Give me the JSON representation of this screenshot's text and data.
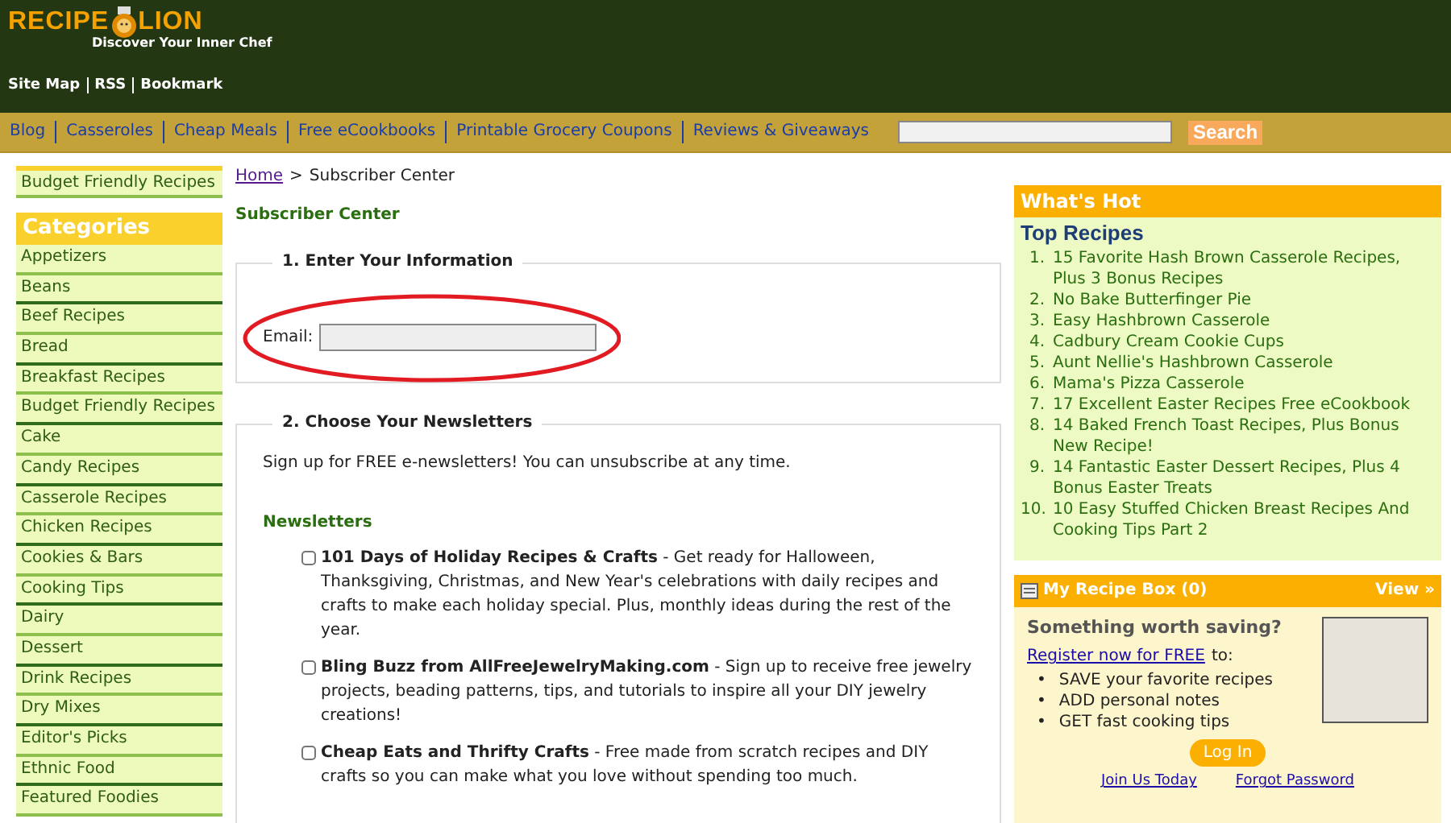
{
  "header": {
    "logo_left": "RECIPE",
    "logo_right": "LION",
    "tagline": "Discover Your Inner Chef",
    "top_links": [
      "Site Map",
      "RSS",
      "Bookmark"
    ]
  },
  "nav": {
    "items": [
      "Blog",
      "Casseroles",
      "Cheap Meals",
      "Free eCookbooks",
      "Printable Grocery Coupons",
      "Reviews & Giveaways"
    ],
    "search_button": "Search"
  },
  "sidebar": {
    "promo": "Budget Friendly Recipes",
    "categories_title": "Categories",
    "categories": [
      "Appetizers",
      "Beans",
      "Beef Recipes",
      "Bread",
      "Breakfast Recipes",
      "Budget Friendly Recipes",
      "Cake",
      "Candy Recipes",
      "Casserole Recipes",
      "Chicken Recipes",
      "Cookies & Bars",
      "Cooking Tips",
      "Dairy",
      "Dessert",
      "Drink Recipes",
      "Dry Mixes",
      "Editor's Picks",
      "Ethnic Food",
      "Featured Foodies"
    ]
  },
  "breadcrumb": {
    "home": "Home",
    "separator": ">",
    "current": "Subscriber Center"
  },
  "page_title": "Subscriber Center",
  "section_1": {
    "legend": "1. Enter Your Information",
    "email_label": "Email:"
  },
  "section_2": {
    "legend": "2. Choose Your Newsletters",
    "intro": "Sign up for FREE e-newsletters! You can unsubscribe at any time.",
    "heading": "Newsletters",
    "newsletters": [
      {
        "checked": false,
        "text": "**101 Days of Holiday Recipes & Crafts** - Get ready for Halloween, Thanksgiving, Christmas, and New Year's celebrations with daily recipes and crafts to make each holiday special. Plus, monthly ideas during the rest of the year."
      },
      {
        "checked": false,
        "text": "**Bling Buzz from AllFreeJewelryMaking.com** - Sign up to receive free jewelry projects, beading patterns, tips, and tutorials to inspire all your DIY jewelry creations!"
      },
      {
        "checked": false,
        "text": "**Cheap Eats and Thrifty Crafts** - Free made from scratch recipes and DIY crafts so you can make what you love without spending too much."
      }
    ]
  },
  "whats_hot": {
    "title": "What's Hot",
    "subtitle": "Top Recipes",
    "recipes": [
      {
        "number": "1.",
        "title": "15 Favorite Hash Brown Casserole Recipes, Plus 3 Bonus Recipes"
      },
      {
        "number": "2.",
        "title": "No Bake Butterfinger Pie"
      },
      {
        "number": "3.",
        "title": "Easy Hashbrown Casserole"
      },
      {
        "number": "4.",
        "title": "Cadbury Cream Cookie Cups"
      },
      {
        "number": "5.",
        "title": "Aunt Nellie's Hashbrown Casserole"
      },
      {
        "number": "6.",
        "title": "Mama's Pizza Casserole"
      },
      {
        "number": "7.",
        "title": "17 Excellent Easter Recipes Free eCookbook"
      },
      {
        "number": "8.",
        "title": "14 Baked French Toast Recipes, Plus Bonus New Recipe!"
      },
      {
        "number": "9.",
        "title": "14 Fantastic Easter Dessert Recipes, Plus 4 Bonus Easter Treats"
      },
      {
        "number": "10.",
        "title": "10 Easy Stuffed Chicken Breast Recipes And Cooking Tips Part 2"
      }
    ]
  },
  "recipe_box": {
    "title": "My Recipe Box (0)",
    "view_link": "View »",
    "question": "Something worth saving?",
    "register_link": "Register now for FREE",
    "register_suffix": "to:",
    "bullet": "•",
    "benefits": [
      "SAVE your favorite recipes",
      "ADD personal notes",
      "GET fast cooking tips"
    ],
    "login_button": "Log In",
    "footer_links": [
      "Join Us Today",
      "Forgot Password"
    ]
  }
}
